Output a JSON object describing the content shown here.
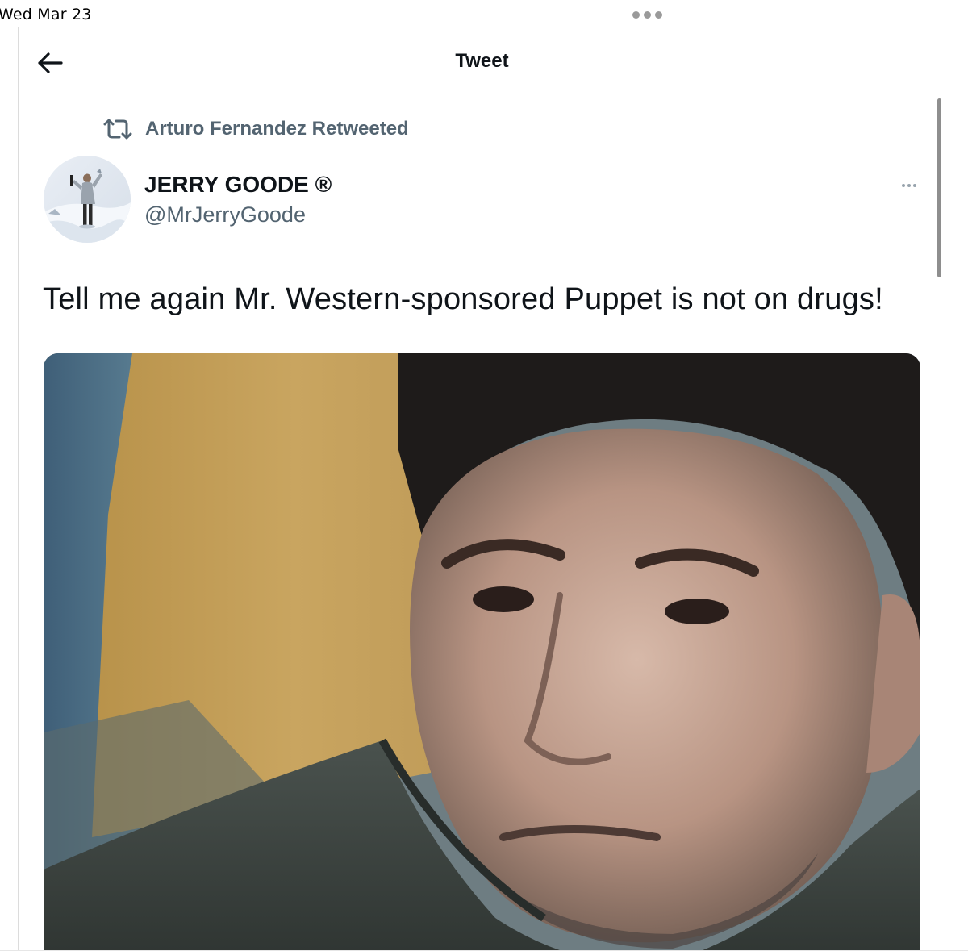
{
  "status_bar": {
    "time": "Wed Mar 23"
  },
  "header": {
    "title": "Tweet",
    "back_icon": "arrow-left-icon"
  },
  "social_context": {
    "icon": "retweet-icon",
    "text": "Arturo Fernandez Retweeted"
  },
  "tweet": {
    "author": {
      "display_name": "JERRY GOODE ®",
      "handle": "@MrJerryGoode",
      "avatar": "avatar-person-in-snow"
    },
    "more_icon": "more-horizontal-icon",
    "text": "Tell me again Mr. Western-sponsored Puppet is not on drugs!",
    "media": {
      "type": "photo",
      "alt": "close-up of a man's face"
    }
  },
  "colors": {
    "primary_text": "#0f1419",
    "secondary_text": "#536471",
    "border": "#dcdcdc"
  }
}
